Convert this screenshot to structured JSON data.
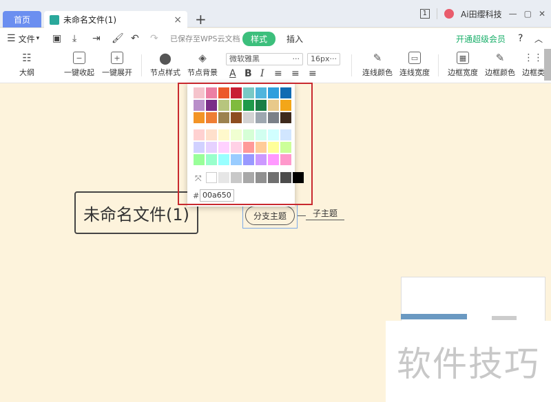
{
  "tabs": {
    "home": "首页",
    "doc_title": "未命名文件(1)",
    "close": "×",
    "add": "+"
  },
  "titlebar": {
    "window_count": "1",
    "account_name": "Ai田缨科技"
  },
  "menu": {
    "file": "文件",
    "saved_status": "已保存至WPS云文档",
    "style_tab": "样式",
    "insert_tab": "插入",
    "upgrade": "开通超级会员",
    "help": "?"
  },
  "toolbar": {
    "outline": "大纲",
    "collapse_all": "一键收起",
    "expand_all": "一键展开",
    "node_style": "节点样式",
    "node_background": "节点背景",
    "font": "微软雅黑",
    "font_size": "16px",
    "line_color": "连线颜色",
    "line_width": "连线宽度",
    "border_width": "边框宽度",
    "border_color": "边框颜色",
    "border_type": "边框类"
  },
  "colors": {
    "accent_green": "#3cbf7c",
    "highlight_red": "#c8282e",
    "row1": [
      "#f5c3cc",
      "#ec7fa4",
      "#ec5a2a",
      "#c81e34",
      "#78c9c5",
      "#4fb5dd",
      "#2f9fdd",
      "#0f6bb3"
    ],
    "row2": [
      "#b98fc9",
      "#7a2d88",
      "#b7c57e",
      "#7fbb3d",
      "#1e9a4a",
      "#1a7e46",
      "#e8c98a",
      "#f3a618"
    ],
    "row3": [
      "#f39426",
      "#ef7e35",
      "#9c8250",
      "#8e4d20",
      "#d3d3d3",
      "#9ea7b0",
      "#7b8088",
      "#3e2a1d"
    ],
    "row4": [
      "#ffd1d1",
      "#ffe0cc",
      "#fff9cc",
      "#f0ffd1",
      "#d6ffd6",
      "#d1fff0",
      "#d1ffff",
      "#d1e6ff"
    ],
    "row5": [
      "#d1d1ff",
      "#e6d1ff",
      "#ffd1ff",
      "#ffd1e6",
      "#ff9999",
      "#ffcc99",
      "#ffff99",
      "#ccff99"
    ],
    "row6": [
      "#99ff99",
      "#99ffcc",
      "#99ffff",
      "#99ccff",
      "#9999ff",
      "#cc99ff",
      "#ff99ff",
      "#ff99cc"
    ],
    "gray_row": [
      "#ffffff",
      "#e6e6e6",
      "#c8c8c8",
      "#a8a8a8",
      "#909090",
      "#707070",
      "#4c4c4c",
      "#000000"
    ]
  },
  "color_picker": {
    "hex_prefix": "#",
    "hex_value": "00a650"
  },
  "mindmap": {
    "root": "未命名文件(1)",
    "branch": "分支主题",
    "child": "子主题"
  },
  "watermark": "软件技巧"
}
